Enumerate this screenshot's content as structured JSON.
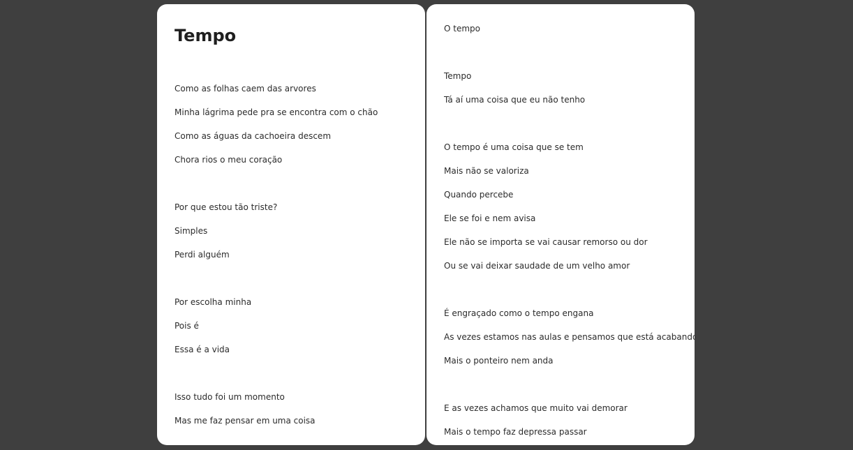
{
  "left_page": {
    "title": "Tempo",
    "lines": [
      "Como as folhas caem das arvores",
      "Minha lágrima pede pra se encontra com o chão",
      "Como as águas da cachoeira descem",
      "Chora rios o meu coração",
      "Por que estou tão triste?",
      "Simples",
      "Perdi alguém",
      "Por escolha minha",
      "Pois é",
      "Essa é a vida",
      "Isso tudo foi um momento",
      "Mas me faz pensar em uma coisa"
    ]
  },
  "right_page": {
    "lines": [
      "O tempo",
      "Tempo",
      "Tá aí uma coisa que eu não tenho",
      "O tempo é uma coisa que se tem",
      "Mais não se valoriza",
      "Quando percebe",
      "Ele se foi e nem avisa",
      "Ele não se importa se vai causar remorso ou dor",
      "Ou se vai deixar saudade de um velho amor",
      "É engraçado como o tempo engana",
      "As vezes estamos nas aulas e pensamos que está acabando",
      "Mais o ponteiro nem anda",
      "E as vezes achamos que muito vai demorar",
      "Mais o tempo faz depressa passar"
    ]
  }
}
